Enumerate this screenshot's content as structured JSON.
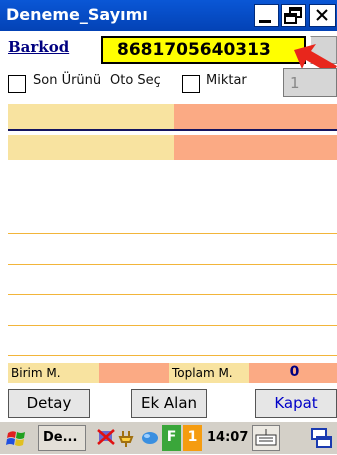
{
  "window": {
    "title": "Deneme_Sayımı"
  },
  "form": {
    "barkod_label": "Barkod",
    "barkod_value": "8681705640313",
    "son_urunu_label": "Son Ürünü",
    "oto_sec_label": "Oto Seç",
    "miktar_label": "Miktar",
    "miktar_value": "1"
  },
  "footer": {
    "birim_label": "Birim M.",
    "toplam_label": "Toplam M.",
    "toplam_value": "0"
  },
  "buttons": {
    "detay": "Detay",
    "ek_alan": "Ek Alan",
    "kapat": "Kapat"
  },
  "taskbar": {
    "app_label": "De...",
    "badge": "1",
    "green_badge": "F",
    "clock": "14:07"
  },
  "colors": {
    "title_bar": "#0a57d6",
    "barcode_bg": "#ffff00",
    "row_yellow": "#f8e3a0",
    "row_salmon": "#fbaa84",
    "accent_arrow": "#e8261c",
    "line_orange": "#f2b53a"
  }
}
